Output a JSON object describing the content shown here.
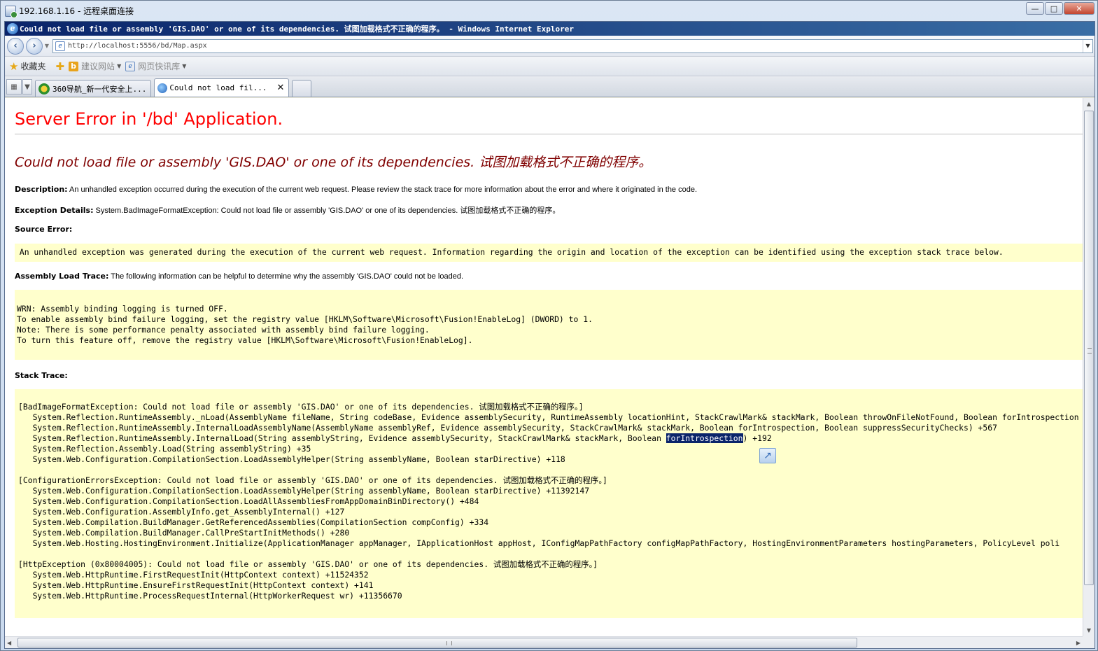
{
  "remote_desktop": {
    "title": "192.168.1.16 - 远程桌面连接",
    "controls": [
      "—",
      "□",
      "✕"
    ]
  },
  "browser": {
    "title": "Could not load file or assembly 'GIS.DAO' or one of its dependencies. 试图加载格式不正确的程序。 - Windows Internet Explorer",
    "url": "http://localhost:5556/bd/Map.aspx",
    "favorites_label": "收藏夹",
    "favorites_items": [
      {
        "label": "建议网站"
      },
      {
        "label": "网页快讯库"
      }
    ],
    "tabs": [
      {
        "label": "360导航_新一代安全上...",
        "active": false
      },
      {
        "label": "Could not load fil...",
        "active": true
      }
    ]
  },
  "page": {
    "heading": "Server Error in '/bd' Application.",
    "error_title": "Could not load file or assembly 'GIS.DAO' or one of its dependencies. 试图加载格式不正确的程序。",
    "description_label": "Description:",
    "description_text": " An unhandled exception occurred during the execution of the current web request. Please review the stack trace for more information about the error and where it originated in the code.",
    "exception_label": "Exception Details:",
    "exception_text": " System.BadImageFormatException: Could not load file or assembly 'GIS.DAO' or one of its dependencies. 试图加载格式不正确的程序。",
    "source_error_label": "Source Error:",
    "source_error_text": " An unhandled exception was generated during the execution of the current web request. Information regarding the origin and location of the exception can be identified using the exception stack trace below.",
    "assembly_trace_label": "Assembly Load Trace:",
    "assembly_trace_text": " The following information can be helpful to determine why the assembly 'GIS.DAO' could not be loaded.",
    "assembly_trace_box": [
      "WRN: Assembly binding logging is turned OFF.",
      "To enable assembly bind failure logging, set the registry value [HKLM\\Software\\Microsoft\\Fusion!EnableLog] (DWORD) to 1.",
      "Note: There is some performance penalty associated with assembly bind failure logging.",
      "To turn this feature off, remove the registry value [HKLM\\Software\\Microsoft\\Fusion!EnableLog]."
    ],
    "stack_trace_label": "Stack Trace:",
    "stack_trace": [
      {
        "header": "[BadImageFormatException: Could not load file or assembly 'GIS.DAO' or one of its dependencies. 试图加载格式不正确的程序。]",
        "lines": [
          "   System.Reflection.RuntimeAssembly._nLoad(AssemblyName fileName, String codeBase, Evidence assemblySecurity, RuntimeAssembly locationHint, StackCrawlMark& stackMark, Boolean throwOnFileNotFound, Boolean forIntrospection",
          "   System.Reflection.RuntimeAssembly.InternalLoadAssemblyName(AssemblyName assemblyRef, Evidence assemblySecurity, StackCrawlMark& stackMark, Boolean forIntrospection, Boolean suppressSecurityChecks) +567",
          "   System.Reflection.RuntimeAssembly.InternalLoad(String assemblyString, Evidence assemblySecurity, StackCrawlMark& stackMark, Boolean ",
          "   System.Reflection.Assembly.Load(String assemblyString) +35",
          "   System.Web.Configuration.CompilationSection.LoadAssemblyHelper(String assemblyName, Boolean starDirective) +118"
        ],
        "selected_word": "forIntrospection",
        "selected_suffix": ") +192"
      },
      {
        "header": "[ConfigurationErrorsException: Could not load file or assembly 'GIS.DAO' or one of its dependencies. 试图加载格式不正确的程序。]",
        "lines": [
          "   System.Web.Configuration.CompilationSection.LoadAssemblyHelper(String assemblyName, Boolean starDirective) +11392147",
          "   System.Web.Configuration.CompilationSection.LoadAllAssembliesFromAppDomainBinDirectory() +484",
          "   System.Web.Configuration.AssemblyInfo.get_AssemblyInternal() +127",
          "   System.Web.Compilation.BuildManager.GetReferencedAssemblies(CompilationSection compConfig) +334",
          "   System.Web.Compilation.BuildManager.CallPreStartInitMethods() +280",
          "   System.Web.Hosting.HostingEnvironment.Initialize(ApplicationManager appManager, IApplicationHost appHost, IConfigMapPathFactory configMapPathFactory, HostingEnvironmentParameters hostingParameters, PolicyLevel poli"
        ]
      },
      {
        "header": "[HttpException (0x80004005): Could not load file or assembly 'GIS.DAO' or one of its dependencies. 试图加载格式不正确的程序。]",
        "lines": [
          "   System.Web.HttpRuntime.FirstRequestInit(HttpContext context) +11524352",
          "   System.Web.HttpRuntime.EnsureFirstRequestInit(HttpContext context) +141",
          "   System.Web.HttpRuntime.ProcessRequestInternal(HttpWorkerRequest wr) +11356670"
        ]
      }
    ]
  },
  "colors": {
    "heading": "#ff0000",
    "error_title": "#800000",
    "code_bg": "#ffffcc",
    "selection": "#0a246a"
  }
}
